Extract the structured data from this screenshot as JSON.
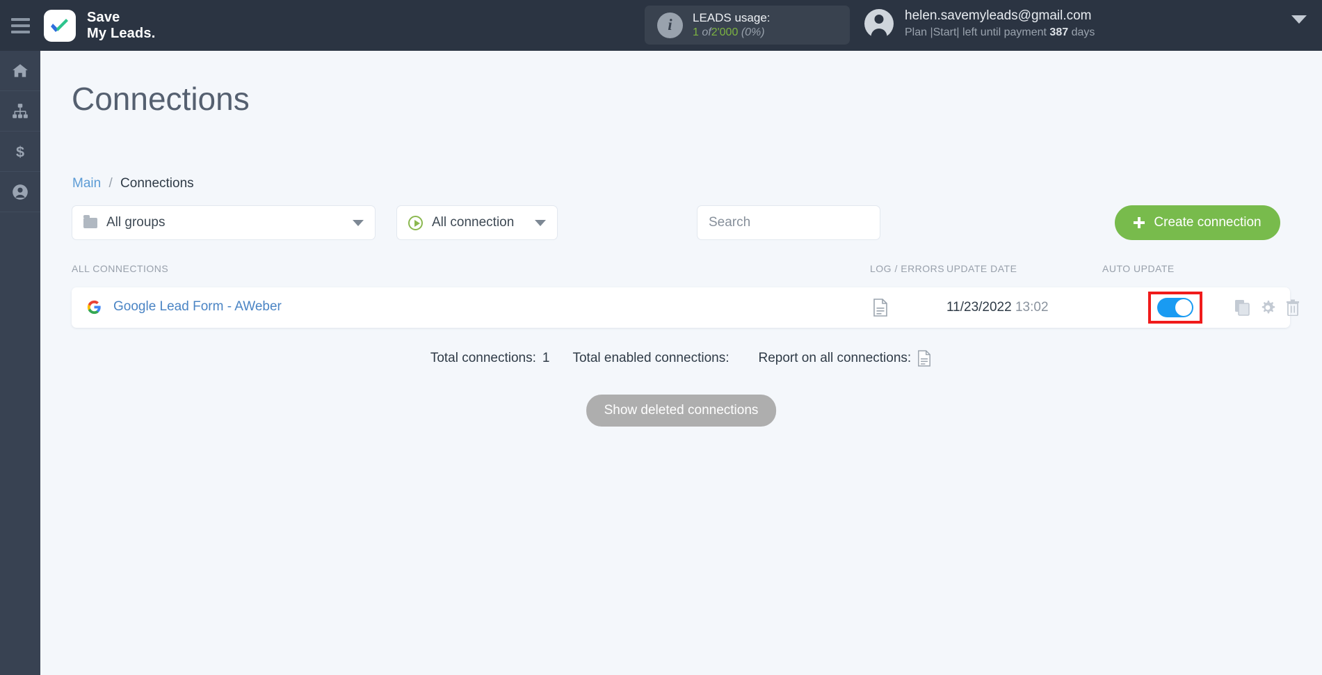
{
  "topbar": {
    "menu_icon": "hamburger-icon",
    "brand_line1": "Save",
    "brand_line2": "My Leads.",
    "leads_usage": {
      "icon": "info-icon",
      "title": "LEADS usage:",
      "used": "1",
      "of": "of",
      "limit": "2'000",
      "percent": "(0%)"
    },
    "account": {
      "avatar_icon": "user-avatar-icon",
      "email": "helen.savemyleads@gmail.com",
      "plan_prefix": "Plan |Start| left until payment",
      "plan_days": "387",
      "plan_suffix": "days",
      "caret_icon": "chevron-down-icon"
    }
  },
  "sidebar": {
    "items": [
      {
        "name": "home",
        "icon": "home-icon"
      },
      {
        "name": "connections",
        "icon": "sitemap-icon"
      },
      {
        "name": "billing",
        "icon": "dollar-icon"
      },
      {
        "name": "account",
        "icon": "user-circle-icon"
      }
    ]
  },
  "page": {
    "title": "Connections",
    "breadcrumb": {
      "root": "Main",
      "separator": "/",
      "current": "Connections"
    }
  },
  "filters": {
    "groups": {
      "icon": "folder-icon",
      "label": "All groups",
      "chevron": "chevron-down-icon"
    },
    "connection_type": {
      "icon": "play-circle-icon",
      "label": "All connection",
      "chevron": "chevron-down-icon"
    },
    "search": {
      "placeholder": "Search",
      "value": ""
    },
    "create_button": {
      "icon": "plus-icon",
      "label": "Create connection"
    }
  },
  "table": {
    "headers": {
      "all_connections": "ALL CONNECTIONS",
      "log_errors": "LOG / ERRORS",
      "update_date": "UPDATE DATE",
      "auto_update": "AUTO UPDATE"
    },
    "rows": [
      {
        "service_icon": "google-icon",
        "name": "Google Lead Form - AWeber",
        "log_icon": "document-icon",
        "date": "11/23/2022",
        "time": "13:02",
        "auto_update_enabled": true,
        "actions": [
          "copy-icon",
          "gear-icon",
          "trash-icon"
        ]
      }
    ]
  },
  "totals": {
    "total_connections_label": "Total connections:",
    "total_connections_value": "1",
    "total_enabled_label": "Total enabled connections:",
    "total_enabled_value": "",
    "report_label": "Report on all connections:",
    "report_icon": "document-icon"
  },
  "footer": {
    "show_deleted_label": "Show deleted connections"
  },
  "colors": {
    "topbar_bg": "#2b3442",
    "sidebar_bg": "#384252",
    "page_bg": "#f4f7fb",
    "accent_green": "#78bb4c",
    "link_blue": "#4a84c4",
    "toggle_on": "#199bf2",
    "highlight_red": "#f01b1b"
  }
}
